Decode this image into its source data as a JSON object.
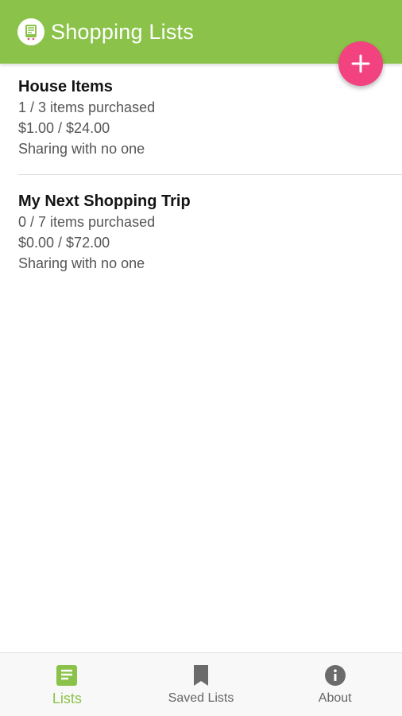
{
  "appbar": {
    "title": "Shopping Lists"
  },
  "fab": {
    "icon": "plus-icon",
    "color": "#f2427f"
  },
  "colors": {
    "primary": "#8bc34a",
    "accent": "#f2427f"
  },
  "lists": [
    {
      "name": "House Items",
      "purchased": "1 / 3 items purchased",
      "cost": "$1.00 / $24.00",
      "sharing": "Sharing with no one"
    },
    {
      "name": "My Next Shopping Trip",
      "purchased": "0 / 7 items purchased",
      "cost": "$0.00 / $72.00",
      "sharing": "Sharing with no one"
    }
  ],
  "bottom_nav": [
    {
      "label": "Lists",
      "icon": "list-document-icon",
      "active": true
    },
    {
      "label": "Saved Lists",
      "icon": "bookmark-icon",
      "active": false
    },
    {
      "label": "About",
      "icon": "info-icon",
      "active": false
    }
  ]
}
